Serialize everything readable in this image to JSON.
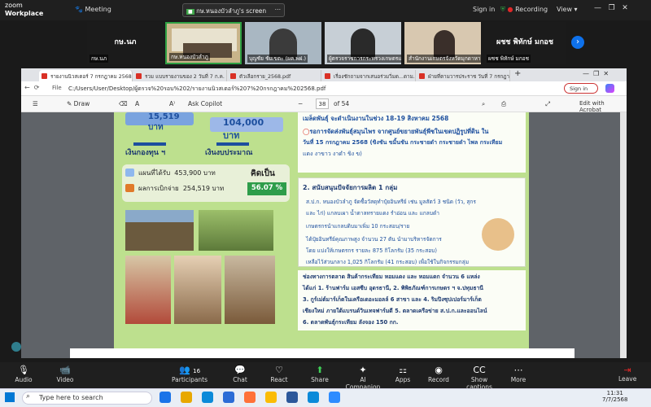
{
  "zoom": {
    "app_line1": "zoom",
    "app_line2": "Workplace",
    "meeting_label": "Meeting",
    "share_label": "กษ.หนองบัวลำภู's screen",
    "signin": "Sign in",
    "recording": "Recording",
    "view": "View"
  },
  "gallery": {
    "tiles": [
      {
        "big": "กษ.นภ",
        "name": "กษ.นภ"
      },
      {
        "big": "",
        "name": "กษ.หนองบัวลำภู"
      },
      {
        "big": "",
        "name": "บุญชัย ชัยเขตะ (ผค.พฝ.)"
      },
      {
        "big": "",
        "name": "ผู้ตรวจราชการกระทรวงเกษตรและ..."
      },
      {
        "big": "",
        "name": "สำนักงานเกษตรจังหวัดมุกดาหาร"
      },
      {
        "big": "ผชช พิทักษ์ มกอช",
        "name": "ผชช พิทักษ์ มกอช"
      }
    ]
  },
  "browser": {
    "tabs": [
      "รายงานนิวสเตอร์ 7 กรกฎาคม 2568.pdf",
      "รวม แบบรายงานของ 2 วันที่ 7 ก.ค. 25...",
      "ตัวเลือกราย_2568.pdf",
      "เรื่องชักถามจากเสนอร่วมวิ่มด...ดาม...",
      "ฝ่ายที่ตามวารประราช วันที่ 7 กรกฎาคม..."
    ],
    "file_label": "File",
    "url": "C:/Users/User/Desktop/ผู้ตรวจ%20รอบ%202/รายงานนิวสเตอร์%207%20กรกฎาคม%202568.pdf",
    "sign_in": "Sign in",
    "toolbar": {
      "draw": "Draw",
      "copilot": "Ask Copilot",
      "page": "38",
      "of": "of 54",
      "acrobat": "Edit with Acrobat"
    }
  },
  "pdf": {
    "stat1": "15,519 บาท",
    "stat2": "104,000 บาท",
    "label_fund": "เงินกองทุน ฯ",
    "label_budget": "เงินงบประมาณ",
    "plan_label": "แผนที่ได้รับ",
    "plan_value": "453,900 บาท",
    "result_label": "ผลการเบิกจ่าย",
    "result_value": "254,519 บาท",
    "ratio_label": "คิดเป็น",
    "ratio_value": "56.07 %",
    "top_right_1": "เมล็ดพันธุ์ จะดำเนินงานในช่วง 18-19 สิงหาคม 2568",
    "top_right_2": "รอการจัดส่งพันธุ์สมุนไพร จากศูนย์ขยายพันธุ์พืชในเขตปฏิรูปที่ดิน ใน",
    "top_right_3": "วันที่ 15 กรกฎาคม 2568 (ขิงชัน ขมิ้นชัน กระชายดำ กระชายดำ ไพล กระเทียม",
    "top_right_4": "แดง งาขาว งาดำ ขิง ข)",
    "item2_title": "2. สนับสนุนปัจจัยการผลิต 1 กลุ่ม",
    "item2_line1": "ส.ป.ก. หนองบัวลำภู จัดซื้อวัสดุทำปุ๋ยอินทรีย์ เช่น มูลสัตว์ 3 ชนิด (วัว, สุกร",
    "item2_line2": "และ ไก่) แกลบเผา น้ำตาลทรายแดง รำอ่อน และ แกลบดำ",
    "item2_line3": "เกษตรกรนำแกลบดิบมาเพิ่ม 10 กระสอบ/ราย",
    "item2_line4": "ได้ปุ๋ยอินทรีย์คุณภาพสูง จำนวน 27 ตัน นำมาบริหารจัดการ",
    "item2_line5": "โดย แบ่งให้เกษตรกร รายละ 875 กิโลกรัม (35 กระสอบ)",
    "item2_line6": "เหลือไว้ส่วนกลาง 1,025 กิโลกรัม (41 กระสอบ) เพื่อใช้ในกิจกรรมกลุ่ม",
    "market_1": "ช่องทางการตลาด สินค้ากระเทียม หอมแดง และ หอมแดก จำนวน 6 แหล่ง",
    "market_2": "ได้แก่ 1. ร้านฟาร์ม เอสซีบ อุดรธานี, 2. พิพิธภัณฑ์การเกษตร ฯ จ.ปทุมธานี",
    "market_3": "3. กูร์เม่ต์มาร์เก็ตในเครือเดอะมอลล์ 6 สาขา และ 4. ริมปิงซุปเปอร์มาร์เก็ต",
    "market_4": "เชียงใหม่ ภายใต้แบรนด์วินเทจฟาร์มดี 5. ตลาดเครือข่าย ส.ป.ก.และออนไลน์",
    "market_5": "6. ตลาดพันธุ์กระเทียม ลังจอง 150 กก."
  },
  "zoombar": {
    "audio": "Audio",
    "video": "Video",
    "participants": "Participants",
    "participants_count": "16",
    "chat": "Chat",
    "react": "React",
    "share": "Share",
    "ai": "AI Companion",
    "apps": "Apps",
    "record": "Record",
    "captions": "Show captions",
    "more": "More",
    "leave": "Leave"
  },
  "taskbar": {
    "search": "Type here to search",
    "time": "11:31",
    "date": "7/7/2568"
  },
  "colors": {
    "page_bg": "#bde08e",
    "ratio_bg": "#2e9d4a",
    "zoom_blue": "#0e71eb",
    "leave_red": "#e02828"
  }
}
